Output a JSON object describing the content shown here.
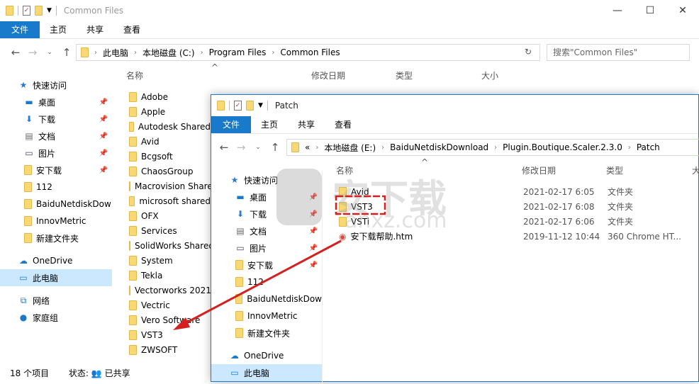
{
  "back": {
    "title": "Common Files",
    "ribbon": [
      "文件",
      "主页",
      "共享",
      "查看"
    ],
    "breadcrumb": [
      "此电脑",
      "本地磁盘 (C:)",
      "Program Files",
      "Common Files"
    ],
    "search_placeholder": "搜索\"Common Files\"",
    "columns": [
      "名称",
      "修改日期",
      "类型",
      "大小"
    ],
    "sidebar": [
      {
        "label": "快速访问",
        "icon": "star-icon"
      },
      {
        "label": "桌面",
        "icon": "desktop-icon",
        "pin": true
      },
      {
        "label": "下载",
        "icon": "download-icon",
        "pin": true
      },
      {
        "label": "文档",
        "icon": "document-icon",
        "pin": true
      },
      {
        "label": "图片",
        "icon": "picture-icon",
        "pin": true
      },
      {
        "label": "安下载",
        "icon": "folder-icon",
        "pin": true
      },
      {
        "label": "112",
        "icon": "folder-icon"
      },
      {
        "label": "BaiduNetdiskDow",
        "icon": "folder-icon"
      },
      {
        "label": "InnovMetric",
        "icon": "folder-icon"
      },
      {
        "label": "新建文件夹",
        "icon": "folder-icon"
      },
      {
        "label": "OneDrive",
        "icon": "cloud-icon"
      },
      {
        "label": "此电脑",
        "icon": "computer-icon",
        "selected": true
      },
      {
        "label": "网络",
        "icon": "network-icon"
      },
      {
        "label": "家庭组",
        "icon": "homegroup-icon"
      }
    ],
    "files": [
      "Adobe",
      "Apple",
      "Autodesk Shared",
      "Avid",
      "Bcgsoft",
      "ChaosGroup",
      "Macrovision Shared",
      "microsoft shared",
      "OFX",
      "Services",
      "SolidWorks Shared",
      "System",
      "Tekla",
      "Vectorworks 2021",
      "Vectric",
      "Vero Software",
      "VST3",
      "ZWSOFT"
    ],
    "status": {
      "count": "18 个项目",
      "state": "状态:",
      "shared": "已共享"
    }
  },
  "front": {
    "title": "Patch",
    "ribbon": [
      "文件",
      "主页",
      "共享",
      "查看"
    ],
    "breadcrumb": [
      "«",
      "本地磁盘 (E:)",
      "BaiduNetdiskDownload",
      "Plugin.Boutique.Scaler.2.3.0",
      "Patch"
    ],
    "columns": [
      "名称",
      "修改日期",
      "类型",
      "大"
    ],
    "sidebar": [
      {
        "label": "快速访问",
        "icon": "star-icon"
      },
      {
        "label": "桌面",
        "icon": "desktop-icon",
        "pin": true
      },
      {
        "label": "下载",
        "icon": "download-icon",
        "pin": true
      },
      {
        "label": "文档",
        "icon": "document-icon",
        "pin": true
      },
      {
        "label": "图片",
        "icon": "picture-icon",
        "pin": true
      },
      {
        "label": "安下载",
        "icon": "folder-icon",
        "pin": true
      },
      {
        "label": "112",
        "icon": "folder-icon"
      },
      {
        "label": "BaiduNetdiskDow",
        "icon": "folder-icon"
      },
      {
        "label": "InnovMetric",
        "icon": "folder-icon"
      },
      {
        "label": "新建文件夹",
        "icon": "folder-icon"
      },
      {
        "label": "OneDrive",
        "icon": "cloud-icon"
      },
      {
        "label": "此电脑",
        "icon": "computer-icon",
        "selected": true
      }
    ],
    "files": [
      {
        "name": "Avid",
        "date": "2021-02-17 6:05",
        "type": "文件夹"
      },
      {
        "name": "VST3",
        "date": "2021-02-17 6:08",
        "type": "文件夹",
        "highlighted": true
      },
      {
        "name": "VSTi",
        "date": "2021-02-17 6:06",
        "type": "文件夹"
      },
      {
        "name": "安下载帮助.htm",
        "date": "2019-11-12 10:44",
        "type": "360 Chrome HT...",
        "icon": "chrome-file-icon"
      }
    ]
  },
  "watermark": "安下载 anxz.com",
  "accent": "#1979ca",
  "annotation_color": "#d4201f"
}
